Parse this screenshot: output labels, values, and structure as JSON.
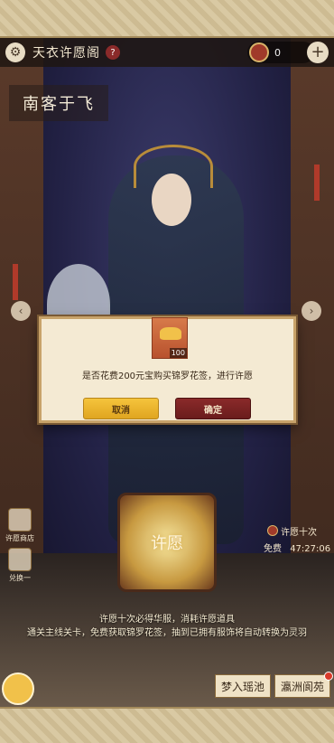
{
  "header": {
    "title": "天衣许愿阁",
    "help": "?",
    "currency_value": "0",
    "plus": "+"
  },
  "pool": {
    "name": "南客于飞"
  },
  "dialog": {
    "item_count": "100",
    "message": "是否花费200元宝购买锦罗花签，进行许愿",
    "cancel": "取消",
    "confirm": "确定"
  },
  "side_buttons": [
    {
      "label": "许愿商店"
    },
    {
      "label": "兑换一"
    }
  ],
  "wish": {
    "label": "许愿",
    "ten_label": "许愿十次",
    "free_label": "免费",
    "free_timer": "47:27:06"
  },
  "hints": {
    "line1": "许愿十次必得华服，消耗许愿道具",
    "line2": "通关主线关卡，免费获取锦罗花签，抽到已拥有服饰将自动转换为灵羽"
  },
  "footer": {
    "dream_pool": "梦入瑶池",
    "yingzhou": "瀛洲阆苑"
  }
}
